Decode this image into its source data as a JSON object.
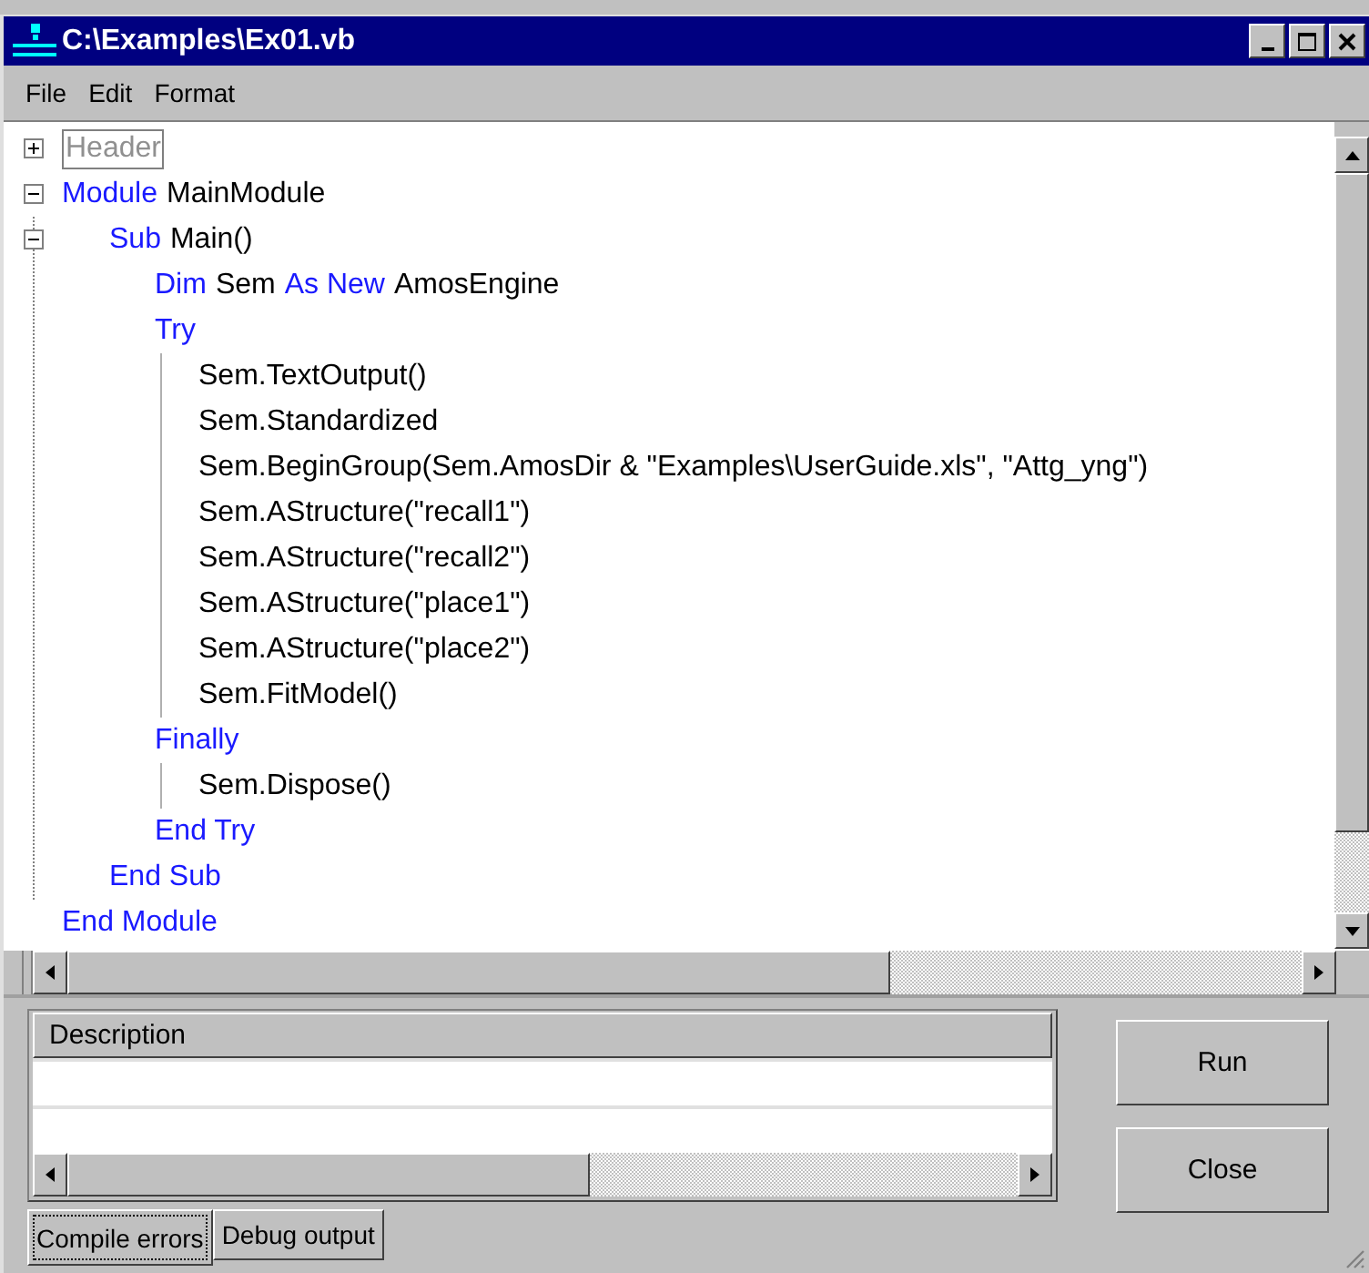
{
  "window": {
    "title": "C:\\Examples\\Ex01.vb"
  },
  "menu": [
    "File",
    "Edit",
    "Format"
  ],
  "code": [
    {
      "expanded": false,
      "tokens": [
        {
          "text": "Header",
          "kind": "folded"
        }
      ]
    },
    {
      "expanded": true,
      "tokens": [
        {
          "text": "Module",
          "kind": "keyword"
        },
        {
          "text": "MainModule",
          "kind": "plain"
        }
      ],
      "children": [
        {
          "expanded": true,
          "tokens": [
            {
              "text": "Sub",
              "kind": "keyword"
            },
            {
              "text": "Main()",
              "kind": "plain"
            }
          ],
          "children": [
            {
              "tokens": [
                {
                  "text": "Dim",
                  "kind": "keyword"
                },
                {
                  "text": "Sem",
                  "kind": "plain"
                },
                {
                  "text": "As New",
                  "kind": "keyword"
                },
                {
                  "text": "AmosEngine",
                  "kind": "plain"
                }
              ]
            },
            {
              "tokens": [
                {
                  "text": "Try",
                  "kind": "keyword"
                }
              ],
              "children": [
                {
                  "tokens": [
                    {
                      "text": "Sem.TextOutput()",
                      "kind": "plain"
                    }
                  ]
                },
                {
                  "tokens": [
                    {
                      "text": "Sem.Standardized",
                      "kind": "plain"
                    }
                  ]
                },
                {
                  "tokens": [
                    {
                      "text": "Sem.BeginGroup(Sem.AmosDir & \"Examples\\UserGuide.xls\", \"Attg_yng\")",
                      "kind": "plain"
                    }
                  ]
                },
                {
                  "tokens": [
                    {
                      "text": "Sem.AStructure(\"recall1\")",
                      "kind": "plain"
                    }
                  ]
                },
                {
                  "tokens": [
                    {
                      "text": "Sem.AStructure(\"recall2\")",
                      "kind": "plain"
                    }
                  ]
                },
                {
                  "tokens": [
                    {
                      "text": "Sem.AStructure(\"place1\")",
                      "kind": "plain"
                    }
                  ]
                },
                {
                  "tokens": [
                    {
                      "text": "Sem.AStructure(\"place2\")",
                      "kind": "plain"
                    }
                  ]
                },
                {
                  "tokens": [
                    {
                      "text": "Sem.FitModel()",
                      "kind": "plain"
                    }
                  ]
                }
              ]
            },
            {
              "tokens": [
                {
                  "text": "Finally",
                  "kind": "keyword"
                }
              ],
              "children": [
                {
                  "tokens": [
                    {
                      "text": "Sem.Dispose()",
                      "kind": "plain"
                    }
                  ]
                }
              ]
            },
            {
              "tokens": [
                {
                  "text": "End Try",
                  "kind": "keyword"
                }
              ]
            }
          ]
        },
        {
          "tokens": [
            {
              "text": "End Sub",
              "kind": "keyword"
            }
          ]
        }
      ]
    },
    {
      "tokens": [
        {
          "text": "End Module",
          "kind": "keyword"
        }
      ]
    }
  ],
  "error_list": {
    "columns": [
      "Description"
    ]
  },
  "tabs": [
    {
      "label": "Compile errors",
      "selected": true
    },
    {
      "label": "Debug output",
      "selected": false
    }
  ],
  "buttons": [
    "Run",
    "Close"
  ]
}
